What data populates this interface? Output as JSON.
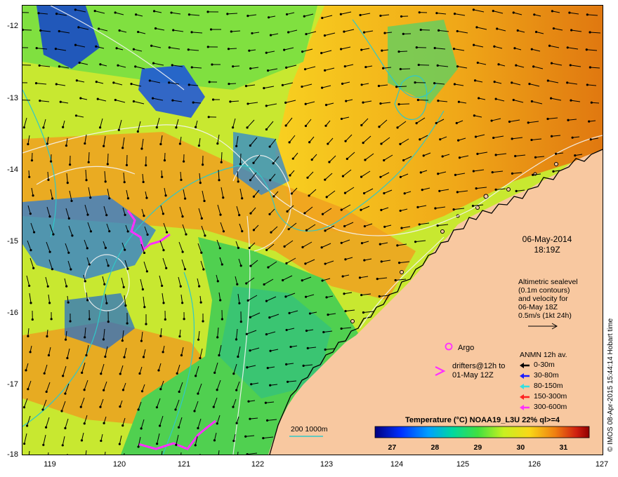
{
  "map": {
    "date_line": "06-May-2014",
    "time_line": "18:19Z",
    "altimetry_lines": [
      "Altimetric sealevel",
      "(0.1m contours)",
      "and velocity for",
      "06-May 18Z",
      "0.5m/s (1kt 24h)"
    ],
    "argo_label": "Argo",
    "drifter_lines": [
      "drifters@12h to",
      "01-May 12Z"
    ],
    "anmn_title": "ANMN 12h av.",
    "anmn_items": [
      {
        "label": "0-30m",
        "color": "#000000"
      },
      {
        "label": "30-80m",
        "color": "#1a1aff"
      },
      {
        "label": "80-150m",
        "color": "#33e0e0"
      },
      {
        "label": "150-300m",
        "color": "#ff2020"
      },
      {
        "label": "300-600m",
        "color": "#ff30ff"
      }
    ],
    "isobath_label": "200  1000m",
    "colorbar": {
      "title": "Temperature (°C) NOAA19_L3U 22% ql>=4",
      "ticks": [
        "27",
        "28",
        "29",
        "30",
        "31"
      ],
      "tick_values": [
        27,
        28,
        29,
        30,
        31
      ],
      "range": [
        26.6,
        31.6
      ]
    },
    "credit": "© IMOS 08-Apr-2015 15:44:14 Hobart time",
    "lat_ticks": [
      "-12",
      "-13",
      "-14",
      "-15",
      "-16",
      "-17",
      "-18"
    ],
    "lon_ticks": [
      "119",
      "120",
      "121",
      "122",
      "123",
      "124",
      "125",
      "126",
      "127"
    ],
    "colors": {
      "land": "#f8c8a0",
      "arrow": "#000000",
      "contour": "#f4f4f4",
      "isobath": "#30c8c8",
      "drifter": "#ff30ff"
    }
  }
}
